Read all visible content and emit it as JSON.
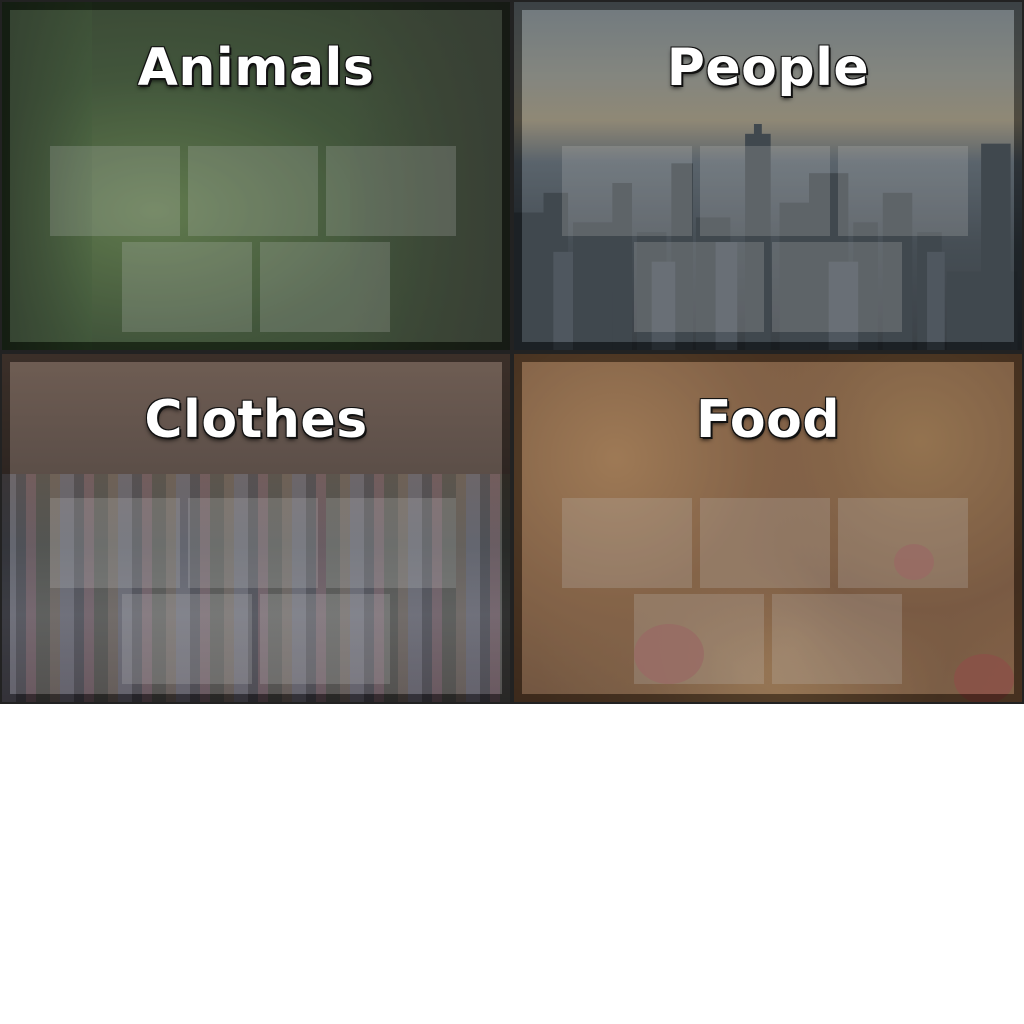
{
  "categories": [
    {
      "id": "animals",
      "title": "Animals"
    },
    {
      "id": "people",
      "title": "People"
    },
    {
      "id": "clothes",
      "title": "Clothes"
    },
    {
      "id": "food",
      "title": "Food"
    }
  ]
}
